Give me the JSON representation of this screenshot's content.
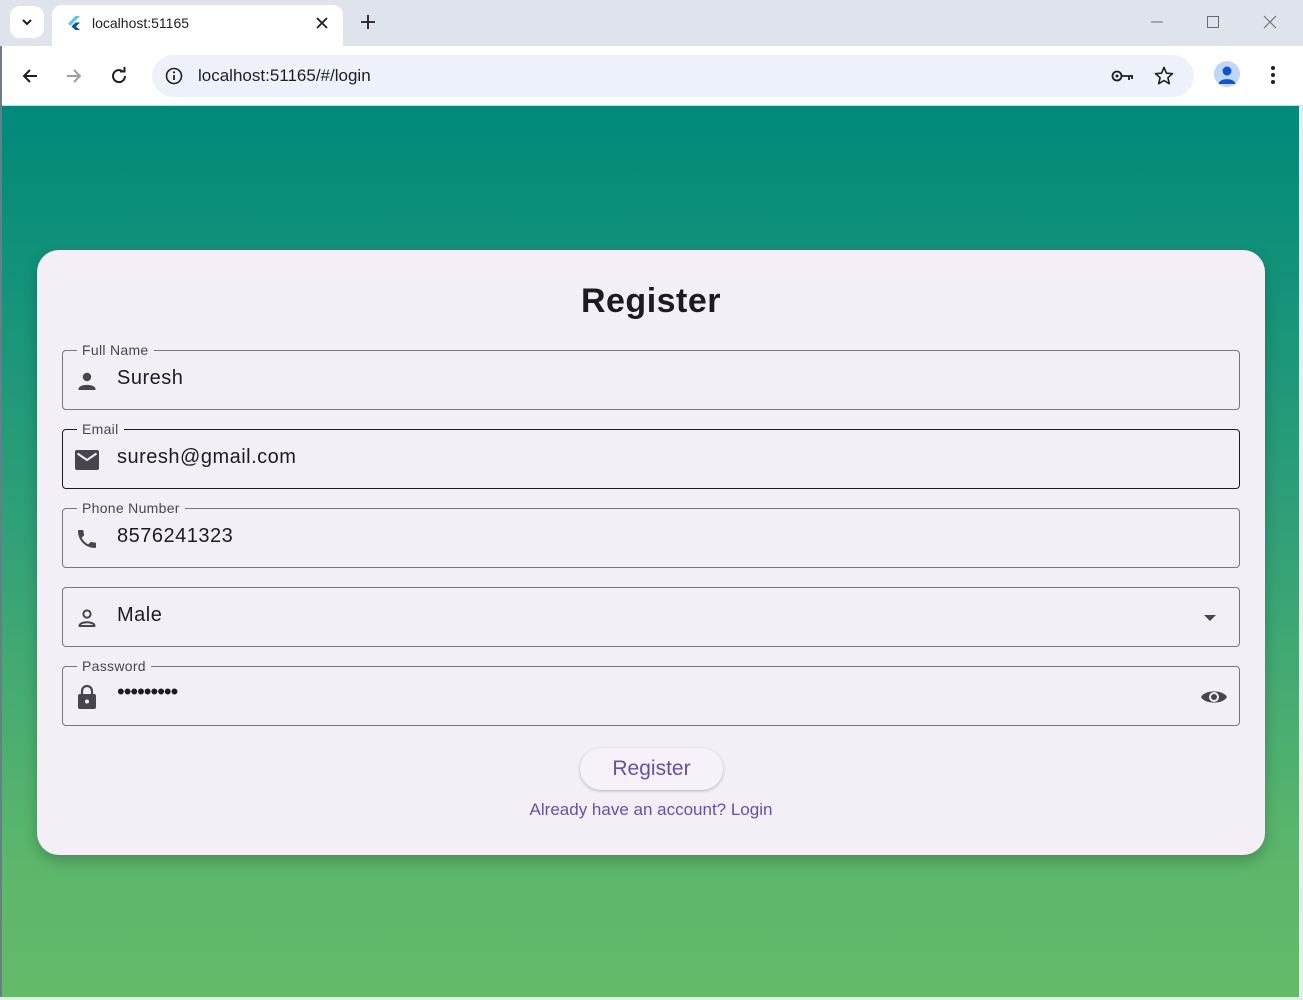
{
  "browser": {
    "tab_title": "localhost:51165",
    "url": "localhost:51165/#/login"
  },
  "form": {
    "title": "Register",
    "fields": [
      {
        "label": "Full Name",
        "value": "Suresh",
        "icon": "person-icon"
      },
      {
        "label": "Email",
        "value": "suresh@gmail.com",
        "icon": "mail-icon"
      },
      {
        "label": "Phone Number",
        "value": "8576241323",
        "icon": "phone-icon"
      },
      {
        "label": "",
        "value": "Male",
        "icon": "person-outline-icon",
        "trailing_icon": "dropdown-arrow-icon"
      },
      {
        "label": "Password",
        "value": "•••••••••",
        "icon": "lock-icon",
        "trailing_icon": "eye-icon"
      }
    ],
    "submit_label": "Register",
    "login_link": "Already have an account? Login"
  },
  "colors": {
    "gradient_top": "#00897b",
    "gradient_bottom": "#63ba68",
    "card_bg": "#f4eff6",
    "accent": "#6750a4"
  }
}
